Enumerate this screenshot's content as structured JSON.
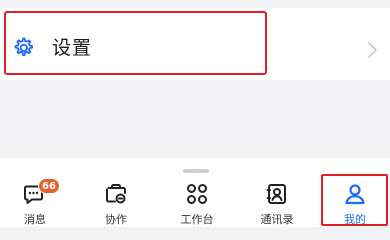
{
  "settings": {
    "label": "设置",
    "icon": "gear-icon",
    "chevron_icon": "chevron-right-icon"
  },
  "tabbar": {
    "tabs": [
      {
        "label": "消息",
        "icon": "message-icon",
        "badge": "66",
        "active": false
      },
      {
        "label": "协作",
        "icon": "collaboration-icon",
        "active": false
      },
      {
        "label": "工作台",
        "icon": "workbench-icon",
        "active": false
      },
      {
        "label": "通讯录",
        "icon": "contacts-icon",
        "active": false
      },
      {
        "label": "我的",
        "icon": "profile-icon",
        "active": true
      }
    ]
  },
  "colors": {
    "accent": "#1f6bf5",
    "badge": "#e8622d",
    "highlight": "#e11d2a"
  }
}
